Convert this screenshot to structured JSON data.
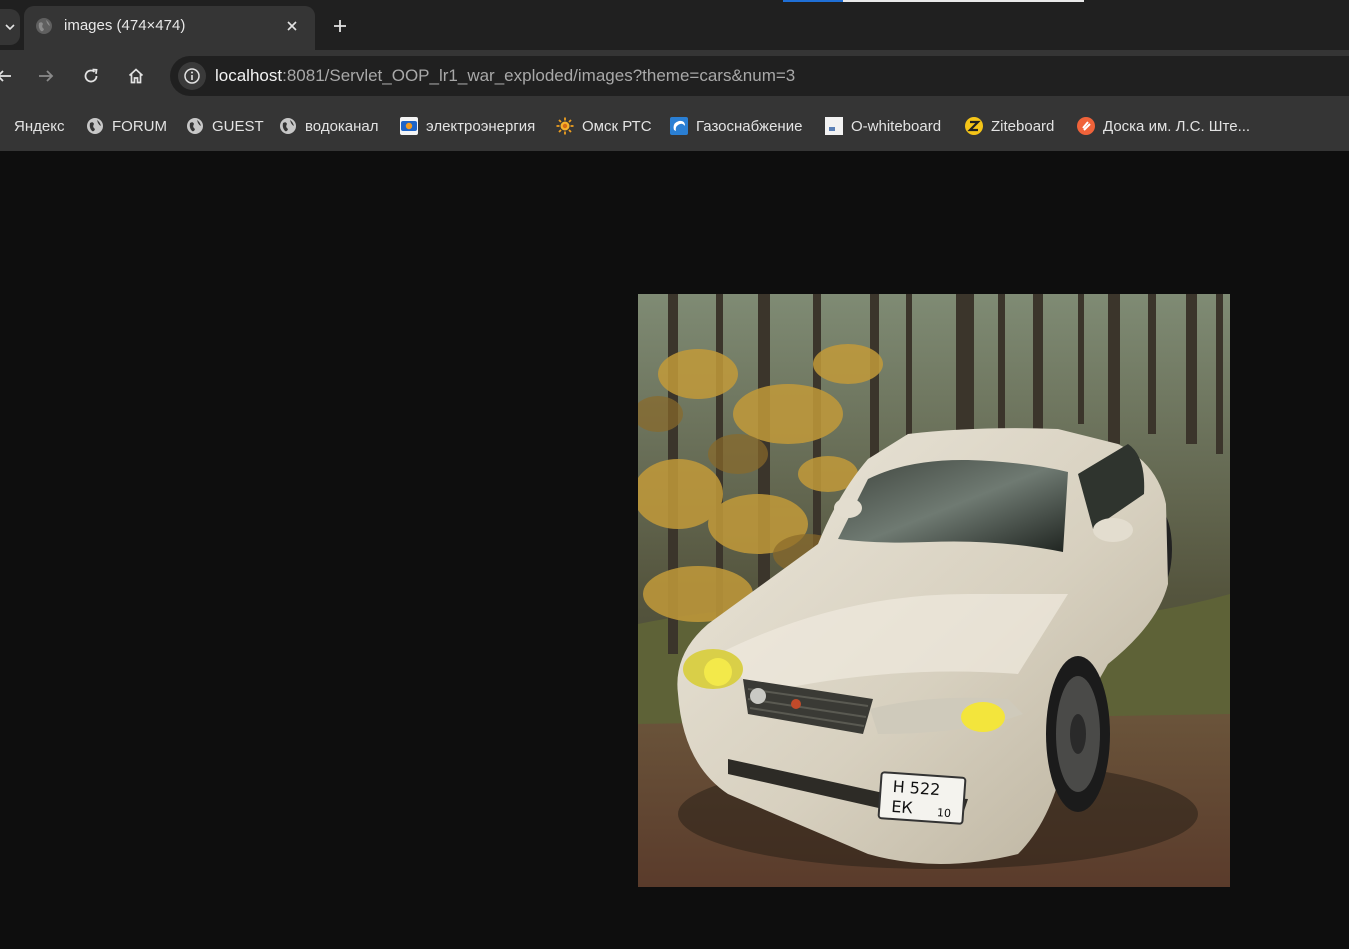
{
  "tab": {
    "title": "images (474×474)",
    "close_icon": "close-icon",
    "new_tab_icon": "plus-icon"
  },
  "toolbar": {
    "url_host": "localhost",
    "url_rest": ":8081/Servlet_OOP_lr1_war_exploded/images?theme=cars&num=3"
  },
  "bookmarks": [
    {
      "label": "Яндекс",
      "icon": "yandex-icon"
    },
    {
      "label": "FORUM",
      "icon": "globe-icon"
    },
    {
      "label": "GUEST",
      "icon": "globe-icon"
    },
    {
      "label": "водоканал",
      "icon": "globe-icon"
    },
    {
      "label": "электроэнергия",
      "icon": "omsk-energy-icon"
    },
    {
      "label": "Омск РТС",
      "icon": "sun-icon"
    },
    {
      "label": "Газоснабжение",
      "icon": "gas-icon"
    },
    {
      "label": "O-whiteboard",
      "icon": "document-icon"
    },
    {
      "label": "Ziteboard",
      "icon": "ziteboard-icon"
    },
    {
      "label": "Доска им. Л.С. Ште...",
      "icon": "orange-board-icon"
    }
  ],
  "image": {
    "plate_line1": "Н 522",
    "plate_line2": "ЕК",
    "plate_region": "10",
    "colors": {
      "car": "#d9d3c2",
      "forest": "#4a4030",
      "leaves": "#c29a3a",
      "ground": "#6a4a36"
    }
  }
}
